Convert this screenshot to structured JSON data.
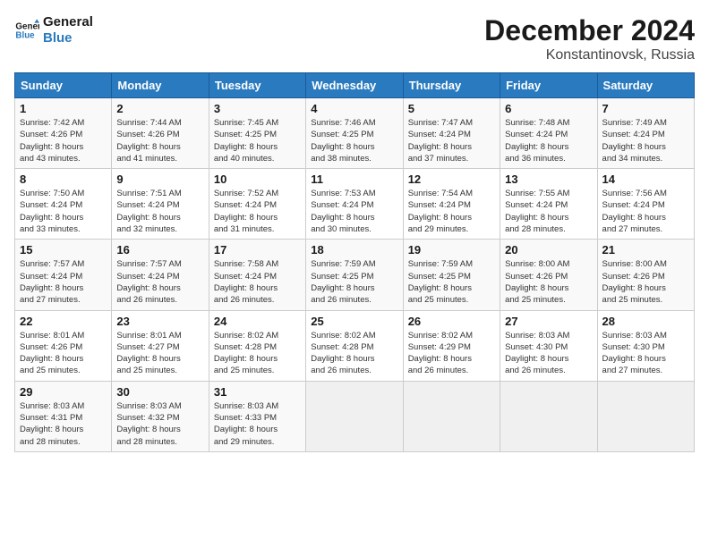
{
  "logo": {
    "line1": "General",
    "line2": "Blue"
  },
  "title": "December 2024",
  "subtitle": "Konstantinovsk, Russia",
  "days_header": [
    "Sunday",
    "Monday",
    "Tuesday",
    "Wednesday",
    "Thursday",
    "Friday",
    "Saturday"
  ],
  "weeks": [
    [
      {
        "day": "1",
        "info": "Sunrise: 7:42 AM\nSunset: 4:26 PM\nDaylight: 8 hours\nand 43 minutes."
      },
      {
        "day": "2",
        "info": "Sunrise: 7:44 AM\nSunset: 4:26 PM\nDaylight: 8 hours\nand 41 minutes."
      },
      {
        "day": "3",
        "info": "Sunrise: 7:45 AM\nSunset: 4:25 PM\nDaylight: 8 hours\nand 40 minutes."
      },
      {
        "day": "4",
        "info": "Sunrise: 7:46 AM\nSunset: 4:25 PM\nDaylight: 8 hours\nand 38 minutes."
      },
      {
        "day": "5",
        "info": "Sunrise: 7:47 AM\nSunset: 4:24 PM\nDaylight: 8 hours\nand 37 minutes."
      },
      {
        "day": "6",
        "info": "Sunrise: 7:48 AM\nSunset: 4:24 PM\nDaylight: 8 hours\nand 36 minutes."
      },
      {
        "day": "7",
        "info": "Sunrise: 7:49 AM\nSunset: 4:24 PM\nDaylight: 8 hours\nand 34 minutes."
      }
    ],
    [
      {
        "day": "8",
        "info": "Sunrise: 7:50 AM\nSunset: 4:24 PM\nDaylight: 8 hours\nand 33 minutes."
      },
      {
        "day": "9",
        "info": "Sunrise: 7:51 AM\nSunset: 4:24 PM\nDaylight: 8 hours\nand 32 minutes."
      },
      {
        "day": "10",
        "info": "Sunrise: 7:52 AM\nSunset: 4:24 PM\nDaylight: 8 hours\nand 31 minutes."
      },
      {
        "day": "11",
        "info": "Sunrise: 7:53 AM\nSunset: 4:24 PM\nDaylight: 8 hours\nand 30 minutes."
      },
      {
        "day": "12",
        "info": "Sunrise: 7:54 AM\nSunset: 4:24 PM\nDaylight: 8 hours\nand 29 minutes."
      },
      {
        "day": "13",
        "info": "Sunrise: 7:55 AM\nSunset: 4:24 PM\nDaylight: 8 hours\nand 28 minutes."
      },
      {
        "day": "14",
        "info": "Sunrise: 7:56 AM\nSunset: 4:24 PM\nDaylight: 8 hours\nand 27 minutes."
      }
    ],
    [
      {
        "day": "15",
        "info": "Sunrise: 7:57 AM\nSunset: 4:24 PM\nDaylight: 8 hours\nand 27 minutes."
      },
      {
        "day": "16",
        "info": "Sunrise: 7:57 AM\nSunset: 4:24 PM\nDaylight: 8 hours\nand 26 minutes."
      },
      {
        "day": "17",
        "info": "Sunrise: 7:58 AM\nSunset: 4:24 PM\nDaylight: 8 hours\nand 26 minutes."
      },
      {
        "day": "18",
        "info": "Sunrise: 7:59 AM\nSunset: 4:25 PM\nDaylight: 8 hours\nand 26 minutes."
      },
      {
        "day": "19",
        "info": "Sunrise: 7:59 AM\nSunset: 4:25 PM\nDaylight: 8 hours\nand 25 minutes."
      },
      {
        "day": "20",
        "info": "Sunrise: 8:00 AM\nSunset: 4:26 PM\nDaylight: 8 hours\nand 25 minutes."
      },
      {
        "day": "21",
        "info": "Sunrise: 8:00 AM\nSunset: 4:26 PM\nDaylight: 8 hours\nand 25 minutes."
      }
    ],
    [
      {
        "day": "22",
        "info": "Sunrise: 8:01 AM\nSunset: 4:26 PM\nDaylight: 8 hours\nand 25 minutes."
      },
      {
        "day": "23",
        "info": "Sunrise: 8:01 AM\nSunset: 4:27 PM\nDaylight: 8 hours\nand 25 minutes."
      },
      {
        "day": "24",
        "info": "Sunrise: 8:02 AM\nSunset: 4:28 PM\nDaylight: 8 hours\nand 25 minutes."
      },
      {
        "day": "25",
        "info": "Sunrise: 8:02 AM\nSunset: 4:28 PM\nDaylight: 8 hours\nand 26 minutes."
      },
      {
        "day": "26",
        "info": "Sunrise: 8:02 AM\nSunset: 4:29 PM\nDaylight: 8 hours\nand 26 minutes."
      },
      {
        "day": "27",
        "info": "Sunrise: 8:03 AM\nSunset: 4:30 PM\nDaylight: 8 hours\nand 26 minutes."
      },
      {
        "day": "28",
        "info": "Sunrise: 8:03 AM\nSunset: 4:30 PM\nDaylight: 8 hours\nand 27 minutes."
      }
    ],
    [
      {
        "day": "29",
        "info": "Sunrise: 8:03 AM\nSunset: 4:31 PM\nDaylight: 8 hours\nand 28 minutes."
      },
      {
        "day": "30",
        "info": "Sunrise: 8:03 AM\nSunset: 4:32 PM\nDaylight: 8 hours\nand 28 minutes."
      },
      {
        "day": "31",
        "info": "Sunrise: 8:03 AM\nSunset: 4:33 PM\nDaylight: 8 hours\nand 29 minutes."
      },
      {
        "day": "",
        "info": ""
      },
      {
        "day": "",
        "info": ""
      },
      {
        "day": "",
        "info": ""
      },
      {
        "day": "",
        "info": ""
      }
    ]
  ]
}
